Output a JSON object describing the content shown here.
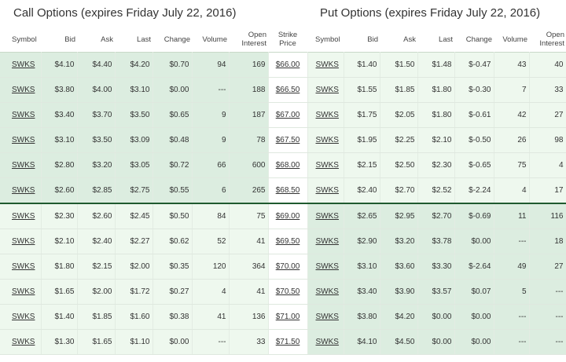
{
  "titles": {
    "call": "Call Options (expires Friday July 22, 2016)",
    "put": "Put Options (expires Friday July 22, 2016)"
  },
  "headers": {
    "symbol": "Symbol",
    "bid": "Bid",
    "ask": "Ask",
    "last": "Last",
    "change": "Change",
    "volume": "Volume",
    "open_interest": "Open Interest",
    "strike_price": "Strike Price"
  },
  "rows": [
    {
      "call": [
        "SWKS",
        "$4.10",
        "$4.40",
        "$4.20",
        "$0.70",
        "94",
        "169"
      ],
      "strike": "$66.00",
      "put": [
        "SWKS",
        "$1.40",
        "$1.50",
        "$1.48",
        "$-0.47",
        "43",
        "40"
      ]
    },
    {
      "call": [
        "SWKS",
        "$3.80",
        "$4.00",
        "$3.10",
        "$0.00",
        "---",
        "188"
      ],
      "strike": "$66.50",
      "put": [
        "SWKS",
        "$1.55",
        "$1.85",
        "$1.80",
        "$-0.30",
        "7",
        "33"
      ]
    },
    {
      "call": [
        "SWKS",
        "$3.40",
        "$3.70",
        "$3.50",
        "$0.65",
        "9",
        "187"
      ],
      "strike": "$67.00",
      "put": [
        "SWKS",
        "$1.75",
        "$2.05",
        "$1.80",
        "$-0.61",
        "42",
        "27"
      ]
    },
    {
      "call": [
        "SWKS",
        "$3.10",
        "$3.50",
        "$3.09",
        "$0.48",
        "9",
        "78"
      ],
      "strike": "$67.50",
      "put": [
        "SWKS",
        "$1.95",
        "$2.25",
        "$2.10",
        "$-0.50",
        "26",
        "98"
      ]
    },
    {
      "call": [
        "SWKS",
        "$2.80",
        "$3.20",
        "$3.05",
        "$0.72",
        "66",
        "600"
      ],
      "strike": "$68.00",
      "put": [
        "SWKS",
        "$2.15",
        "$2.50",
        "$2.30",
        "$-0.65",
        "75",
        "4"
      ]
    },
    {
      "call": [
        "SWKS",
        "$2.60",
        "$2.85",
        "$2.75",
        "$0.55",
        "6",
        "265"
      ],
      "strike": "$68.50",
      "put": [
        "SWKS",
        "$2.40",
        "$2.70",
        "$2.52",
        "$-2.24",
        "4",
        "17"
      ]
    },
    {
      "call": [
        "SWKS",
        "$2.30",
        "$2.60",
        "$2.45",
        "$0.50",
        "84",
        "75"
      ],
      "strike": "$69.00",
      "put": [
        "SWKS",
        "$2.65",
        "$2.95",
        "$2.70",
        "$-0.69",
        "11",
        "116"
      ]
    },
    {
      "call": [
        "SWKS",
        "$2.10",
        "$2.40",
        "$2.27",
        "$0.62",
        "52",
        "41"
      ],
      "strike": "$69.50",
      "put": [
        "SWKS",
        "$2.90",
        "$3.20",
        "$3.78",
        "$0.00",
        "---",
        "18"
      ]
    },
    {
      "call": [
        "SWKS",
        "$1.80",
        "$2.15",
        "$2.00",
        "$0.35",
        "120",
        "364"
      ],
      "strike": "$70.00",
      "put": [
        "SWKS",
        "$3.10",
        "$3.60",
        "$3.30",
        "$-2.64",
        "49",
        "27"
      ]
    },
    {
      "call": [
        "SWKS",
        "$1.65",
        "$2.00",
        "$1.72",
        "$0.27",
        "4",
        "41"
      ],
      "strike": "$70.50",
      "put": [
        "SWKS",
        "$3.40",
        "$3.90",
        "$3.57",
        "$0.07",
        "5",
        "---"
      ]
    },
    {
      "call": [
        "SWKS",
        "$1.40",
        "$1.85",
        "$1.60",
        "$0.38",
        "41",
        "136"
      ],
      "strike": "$71.00",
      "put": [
        "SWKS",
        "$3.80",
        "$4.20",
        "$0.00",
        "$0.00",
        "---",
        "---"
      ]
    },
    {
      "call": [
        "SWKS",
        "$1.30",
        "$1.65",
        "$1.10",
        "$0.00",
        "---",
        "33"
      ],
      "strike": "$71.50",
      "put": [
        "SWKS",
        "$4.10",
        "$4.50",
        "$0.00",
        "$0.00",
        "---",
        "---"
      ]
    }
  ]
}
